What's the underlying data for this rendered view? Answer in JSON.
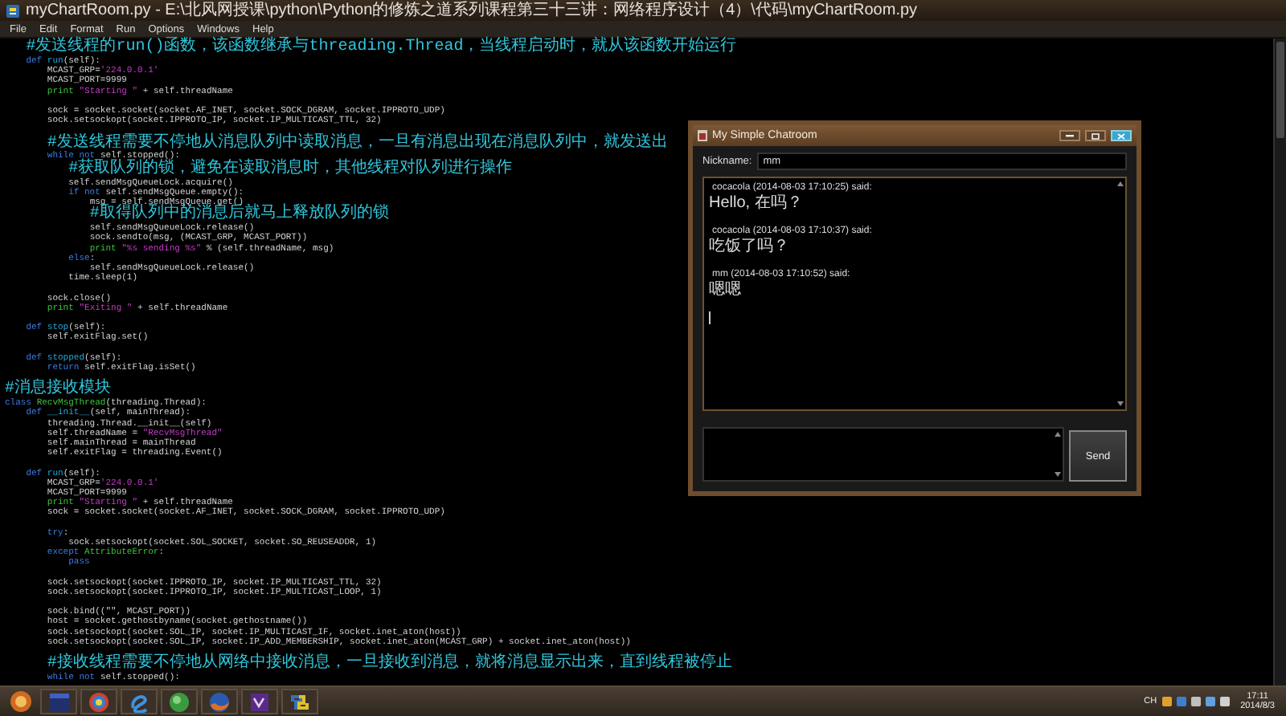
{
  "window": {
    "title": "myChartRoom.py - E:\\北风网授课\\python\\Python的修炼之道系列课程第三十三讲：网络程序设计（4）\\代码\\myChartRoom.py"
  },
  "menu": [
    "File",
    "Edit",
    "Format",
    "Run",
    "Options",
    "Windows",
    "Help"
  ],
  "editor": {
    "lines": [
      {
        "kind": "code",
        "segments": [
          {
            "text": "    #发送线程的run()函数，该函数继承与threading.Thread，当线程启动时，就从该函数开始运行",
            "kind": "comment"
          }
        ]
      },
      {
        "kind": "code",
        "segments": [
          {
            "text": "    def ",
            "kind": "keyword"
          },
          {
            "text": "run",
            "kind": "defname"
          },
          {
            "text": "(self):",
            "kind": "plain"
          }
        ]
      },
      {
        "kind": "code",
        "segments": [
          {
            "text": "        MCAST_GRP=",
            "kind": "plain"
          },
          {
            "text": "'224.0.0.1'",
            "kind": "string"
          }
        ]
      },
      {
        "kind": "code",
        "segments": [
          {
            "text": "        MCAST_PORT=9999",
            "kind": "plain"
          }
        ]
      },
      {
        "kind": "code",
        "segments": [
          {
            "text": "        print ",
            "kind": "builtin"
          },
          {
            "text": "\"Starting \"",
            "kind": "string"
          },
          {
            "text": " + self.threadName",
            "kind": "plain"
          }
        ]
      },
      {
        "kind": "blank"
      },
      {
        "kind": "code",
        "segments": [
          {
            "text": "        sock = socket.socket(socket.AF_INET, socket.SOCK_DGRAM, socket.IPPROTO_UDP)",
            "kind": "plain"
          }
        ]
      },
      {
        "kind": "code",
        "segments": [
          {
            "text": "        sock.setsockopt(socket.IPPROTO_IP, socket.IP_MULTICAST_TTL, 32)",
            "kind": "plain"
          }
        ]
      },
      {
        "kind": "blank"
      },
      {
        "kind": "code",
        "segments": [
          {
            "text": "        #发送线程需要不停地从消息队列中读取消息，一旦有消息出现在消息队列中，就发送出",
            "kind": "comment"
          }
        ]
      },
      {
        "kind": "code",
        "segments": [
          {
            "text": "        while not",
            "kind": "keyword"
          },
          {
            "text": " self.stopped():",
            "kind": "plain"
          }
        ]
      },
      {
        "kind": "code",
        "segments": [
          {
            "text": "            #获取队列的锁，避免在读取消息时，其他线程对队列进行操作",
            "kind": "comment"
          }
        ]
      },
      {
        "kind": "code",
        "segments": [
          {
            "text": "            self.sendMsgQueueLock.acquire()",
            "kind": "plain"
          }
        ]
      },
      {
        "kind": "code",
        "segments": [
          {
            "text": "            if not",
            "kind": "keyword"
          },
          {
            "text": " self.sendMsgQueue.empty():",
            "kind": "plain"
          }
        ]
      },
      {
        "kind": "code",
        "segments": [
          {
            "text": "                msg = self.sendMsgQueue.get()",
            "kind": "plain"
          }
        ]
      },
      {
        "kind": "code",
        "segments": [
          {
            "text": "                #取得队列中的消息后就马上释放队列的锁",
            "kind": "comment"
          }
        ]
      },
      {
        "kind": "code",
        "segments": [
          {
            "text": "                self.sendMsgQueueLock.release()",
            "kind": "plain"
          }
        ]
      },
      {
        "kind": "code",
        "segments": [
          {
            "text": "                sock.sendto(msg, (MCAST_GRP, MCAST_PORT))",
            "kind": "plain"
          }
        ]
      },
      {
        "kind": "code",
        "segments": [
          {
            "text": "                print ",
            "kind": "builtin"
          },
          {
            "text": "\"%s sending %s\"",
            "kind": "string"
          },
          {
            "text": " % (self.threadName, msg)",
            "kind": "plain"
          }
        ]
      },
      {
        "kind": "code",
        "segments": [
          {
            "text": "            else",
            "kind": "keyword"
          },
          {
            "text": ":",
            "kind": "plain"
          }
        ]
      },
      {
        "kind": "code",
        "segments": [
          {
            "text": "                self.sendMsgQueueLock.release()",
            "kind": "plain"
          }
        ]
      },
      {
        "kind": "code",
        "segments": [
          {
            "text": "            time.sleep(1)",
            "kind": "plain"
          }
        ]
      },
      {
        "kind": "blank"
      },
      {
        "kind": "code",
        "segments": [
          {
            "text": "        sock.close()",
            "kind": "plain"
          }
        ]
      },
      {
        "kind": "code",
        "segments": [
          {
            "text": "        print ",
            "kind": "builtin"
          },
          {
            "text": "\"Exiting \"",
            "kind": "string"
          },
          {
            "text": " + self.threadName",
            "kind": "plain"
          }
        ]
      },
      {
        "kind": "blank"
      },
      {
        "kind": "code",
        "segments": [
          {
            "text": "    def ",
            "kind": "keyword"
          },
          {
            "text": "stop",
            "kind": "defname"
          },
          {
            "text": "(self):",
            "kind": "plain"
          }
        ]
      },
      {
        "kind": "code",
        "segments": [
          {
            "text": "        self.exitFlag.set()",
            "kind": "plain"
          }
        ]
      },
      {
        "kind": "blank"
      },
      {
        "kind": "code",
        "segments": [
          {
            "text": "    def ",
            "kind": "keyword"
          },
          {
            "text": "stopped",
            "kind": "defname"
          },
          {
            "text": "(self):",
            "kind": "plain"
          }
        ]
      },
      {
        "kind": "code",
        "segments": [
          {
            "text": "        return",
            "kind": "keyword"
          },
          {
            "text": " self.exitFlag.isSet()",
            "kind": "plain"
          }
        ]
      },
      {
        "kind": "blank"
      },
      {
        "kind": "code",
        "segments": [
          {
            "text": "#消息接收模块",
            "kind": "comment"
          }
        ]
      },
      {
        "kind": "code",
        "segments": [
          {
            "text": "class ",
            "kind": "keyword"
          },
          {
            "text": "RecvMsgThread",
            "kind": "builtin"
          },
          {
            "text": "(threading.Thread):",
            "kind": "plain"
          }
        ]
      },
      {
        "kind": "code",
        "segments": [
          {
            "text": "    def ",
            "kind": "keyword"
          },
          {
            "text": "__init__",
            "kind": "defname"
          },
          {
            "text": "(self, mainThread):",
            "kind": "plain"
          }
        ]
      },
      {
        "kind": "code",
        "segments": [
          {
            "text": "        threading.Thread.__init__(self)",
            "kind": "plain"
          }
        ]
      },
      {
        "kind": "code",
        "segments": [
          {
            "text": "        self.threadName = ",
            "kind": "plain"
          },
          {
            "text": "\"RecvMsgThread\"",
            "kind": "string"
          }
        ]
      },
      {
        "kind": "code",
        "segments": [
          {
            "text": "        self.mainThread = mainThread",
            "kind": "plain"
          }
        ]
      },
      {
        "kind": "code",
        "segments": [
          {
            "text": "        self.exitFlag = threading.Event()",
            "kind": "plain"
          }
        ]
      },
      {
        "kind": "blank"
      },
      {
        "kind": "code",
        "segments": [
          {
            "text": "    def ",
            "kind": "keyword"
          },
          {
            "text": "run",
            "kind": "defname"
          },
          {
            "text": "(self):",
            "kind": "plain"
          }
        ]
      },
      {
        "kind": "code",
        "segments": [
          {
            "text": "        MCAST_GRP=",
            "kind": "plain"
          },
          {
            "text": "'224.0.0.1'",
            "kind": "string"
          }
        ]
      },
      {
        "kind": "code",
        "segments": [
          {
            "text": "        MCAST_PORT=9999",
            "kind": "plain"
          }
        ]
      },
      {
        "kind": "code",
        "segments": [
          {
            "text": "        print ",
            "kind": "builtin"
          },
          {
            "text": "\"Starting \"",
            "kind": "string"
          },
          {
            "text": " + self.threadName",
            "kind": "plain"
          }
        ]
      },
      {
        "kind": "code",
        "segments": [
          {
            "text": "        sock = socket.socket(socket.AF_INET, socket.SOCK_DGRAM, socket.IPPROTO_UDP)",
            "kind": "plain"
          }
        ]
      },
      {
        "kind": "blank"
      },
      {
        "kind": "code",
        "segments": [
          {
            "text": "        try",
            "kind": "keyword"
          },
          {
            "text": ":",
            "kind": "plain"
          }
        ]
      },
      {
        "kind": "code",
        "segments": [
          {
            "text": "            sock.setsockopt(socket.SOL_SOCKET, socket.SO_REUSEADDR, 1)",
            "kind": "plain"
          }
        ]
      },
      {
        "kind": "code",
        "segments": [
          {
            "text": "        except ",
            "kind": "keyword"
          },
          {
            "text": "AttributeError",
            "kind": "builtin"
          },
          {
            "text": ":",
            "kind": "plain"
          }
        ]
      },
      {
        "kind": "code",
        "segments": [
          {
            "text": "            pass",
            "kind": "keyword"
          }
        ]
      },
      {
        "kind": "blank"
      },
      {
        "kind": "code",
        "segments": [
          {
            "text": "        sock.setsockopt(socket.IPPROTO_IP, socket.IP_MULTICAST_TTL, 32)",
            "kind": "plain"
          }
        ]
      },
      {
        "kind": "code",
        "segments": [
          {
            "text": "        sock.setsockopt(socket.IPPROTO_IP, socket.IP_MULTICAST_LOOP, 1)",
            "kind": "plain"
          }
        ]
      },
      {
        "kind": "blank"
      },
      {
        "kind": "code",
        "segments": [
          {
            "text": "        sock.bind((\"\", MCAST_PORT))",
            "kind": "plain"
          }
        ]
      },
      {
        "kind": "code",
        "segments": [
          {
            "text": "        host = socket.gethostbyname(socket.gethostname())",
            "kind": "plain"
          }
        ]
      },
      {
        "kind": "code",
        "segments": [
          {
            "text": "        sock.setsockopt(socket.SOL_IP, socket.IP_MULTICAST_IF, socket.inet_aton(host))",
            "kind": "plain"
          }
        ]
      },
      {
        "kind": "code",
        "segments": [
          {
            "text": "        sock.setsockopt(socket.SOL_IP, socket.IP_ADD_MEMBERSHIP, socket.inet_aton(MCAST_GRP) + socket.inet_aton(host))",
            "kind": "plain"
          }
        ]
      },
      {
        "kind": "blank"
      },
      {
        "kind": "code",
        "segments": [
          {
            "text": "        #接收线程需要不停地从网络中接收消息，一旦接收到消息，就将消息显示出来，直到线程被停止",
            "kind": "comment"
          }
        ]
      },
      {
        "kind": "code",
        "segments": [
          {
            "text": "        while not",
            "kind": "keyword"
          },
          {
            "text": " self.stopped():",
            "kind": "plain"
          }
        ]
      }
    ]
  },
  "chat_window": {
    "title": "My Simple Chatroom",
    "nickname_label": "Nickname:",
    "nickname": "mm",
    "messages": [
      {
        "header": "cocacola (2014-08-03 17:10:25) said:",
        "body": "Hello, 在吗？"
      },
      {
        "header": "cocacola (2014-08-03 17:10:37) said:",
        "body": "吃饭了吗？"
      },
      {
        "header": "mm (2014-08-03 17:10:52) said:",
        "body": "嗯嗯"
      }
    ],
    "caret": true,
    "send_button": "Send"
  },
  "taskbar": {
    "apps": [
      {
        "kind": "start"
      },
      {
        "kind": "window"
      },
      {
        "kind": "ring"
      },
      {
        "kind": "swirl"
      },
      {
        "kind": "globe"
      },
      {
        "kind": "fox"
      },
      {
        "kind": "studio"
      },
      {
        "kind": "snake"
      }
    ],
    "tray": {
      "language": "CH",
      "time": "17:11",
      "date": "2014/8/3"
    }
  }
}
